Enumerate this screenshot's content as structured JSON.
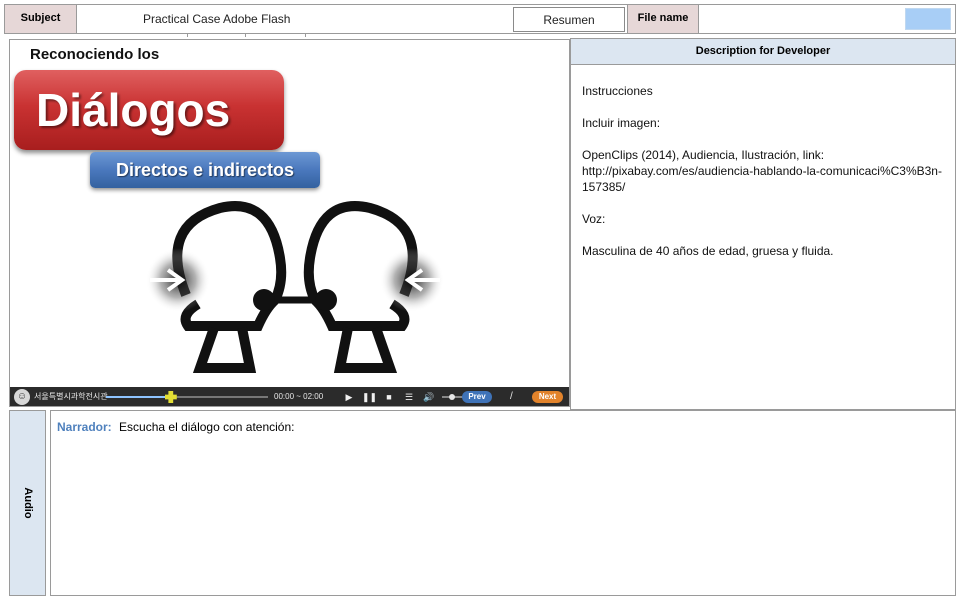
{
  "header": {
    "subject_label": "Subject",
    "subject_value": "Practical Case Adobe Flash",
    "summary_button": "Resumen",
    "filename_label": "File name",
    "filename_color": "#a8cef6"
  },
  "stage": {
    "kicker": "Reconociendo los",
    "title": "Diálogos",
    "subtitle": "Directos e indirectos",
    "illustration": "two-heads-talking-icon",
    "player": {
      "organization": "서울특별시과학전시관",
      "time": "00:00 ~ 02:00",
      "progress": 0.4,
      "prev_label": "Prev",
      "separator": "/",
      "next_label": "Next",
      "icons": [
        "play-icon",
        "pause-icon",
        "stop-icon",
        "menu-icon",
        "volume-icon"
      ],
      "accent_prev": "#3f73b8",
      "accent_next": "#e2832b"
    }
  },
  "description": {
    "heading": "Description for Developer",
    "paragraphs": [
      "Instrucciones",
      "Incluir imagen:",
      "OpenClips (2014), Audiencia, Ilustración, link: http://pixabay.com/es/audiencia-hablando-la-comunicaci%C3%B3n-157385/",
      "Voz:",
      "Masculina de 40 años de edad, gruesa  y fluida."
    ]
  },
  "audio": {
    "label": "Audio",
    "narrator_label": "Narrador:",
    "narrator_text": "Escucha el diálogo con atención:"
  }
}
